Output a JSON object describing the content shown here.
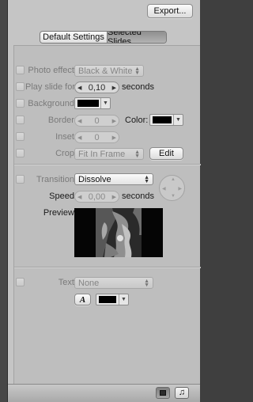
{
  "toolbar": {
    "export_label": "Export..."
  },
  "segment": {
    "default_label": "Default Settings",
    "selected_label": "Selected Slides",
    "active": "Selected Slides"
  },
  "slide": {
    "photo_effect": {
      "label": "Photo effect:",
      "value": "Black & White"
    },
    "play_slide": {
      "label": "Play slide for:",
      "value": "0,10",
      "unit": "seconds"
    },
    "background": {
      "label": "Background:",
      "swatch_color": "#000000"
    },
    "border": {
      "label": "Border:",
      "value": "0",
      "color_label": "Color:",
      "color_swatch": "#000000"
    },
    "inset": {
      "label": "Inset:",
      "value": "0"
    },
    "crop": {
      "label": "Crop:",
      "value": "Fit In Frame",
      "edit_label": "Edit"
    }
  },
  "transition": {
    "label": "Transition:",
    "value": "Dissolve",
    "speed_label": "Speed:",
    "speed_value": "0,00",
    "speed_unit": "seconds",
    "preview_label": "Preview:"
  },
  "text": {
    "label": "Text:",
    "value": "None",
    "font_button": "A",
    "color_swatch": "#000000"
  },
  "bottom": {
    "slide_icon": "slide-view-icon",
    "music_icon": "music-note-icon"
  }
}
